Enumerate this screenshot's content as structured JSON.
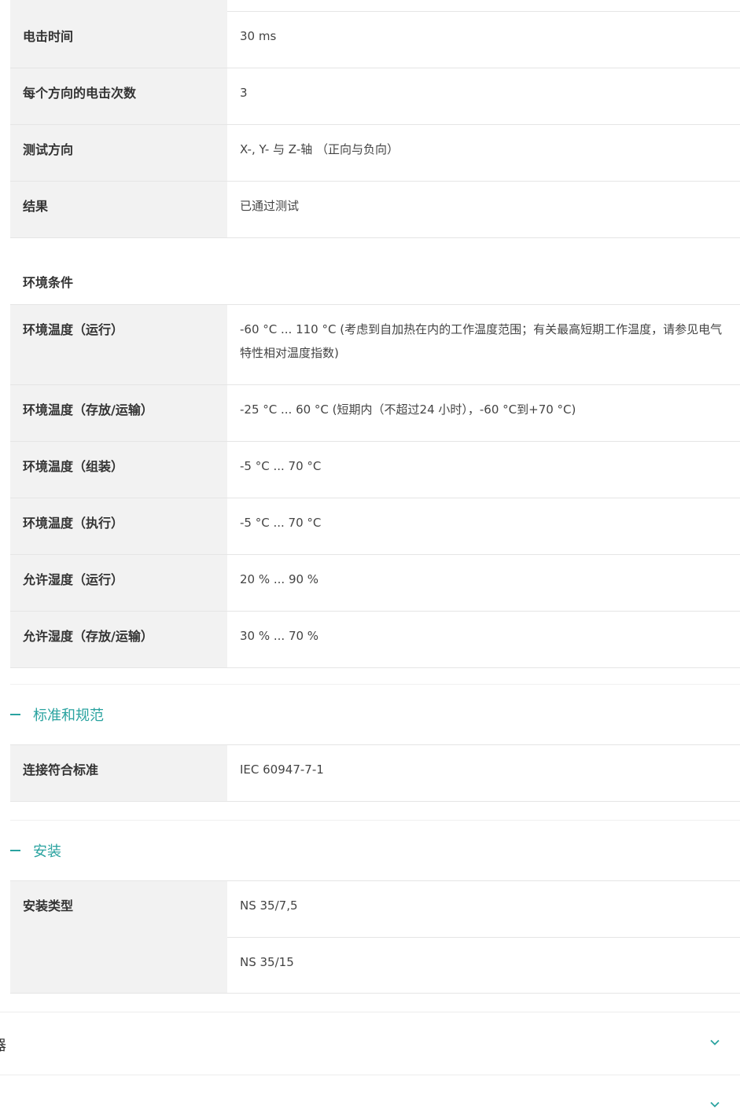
{
  "shock_rows": [
    {
      "label": "电击时间",
      "value": "30 ms"
    },
    {
      "label": "每个方向的电击次数",
      "value": "3"
    },
    {
      "label": "测试方向",
      "value": "X-, Y- 与 Z-轴 （正向与负向）"
    },
    {
      "label": "结果",
      "value": "已通过测试"
    }
  ],
  "env": {
    "heading": "环境条件",
    "rows": [
      {
        "label": "环境温度（运行）",
        "value": "-60 °C ... 110 °C (考虑到自加热在内的工作温度范围；有关最高短期工作温度，请参见电气特性相对温度指数)"
      },
      {
        "label": "环境温度（存放/运输）",
        "value": "-25 °C ... 60 °C (短期内（不超过24 小时），-60 °C到+70 °C)"
      },
      {
        "label": "环境温度（组装）",
        "value": "-5 °C ... 70 °C"
      },
      {
        "label": "环境温度（执行）",
        "value": "-5 °C ... 70 °C"
      },
      {
        "label": "允许湿度（运行）",
        "value": "20 % ... 90 %"
      },
      {
        "label": "允许湿度（存放/运输）",
        "value": "30 % ... 70 %"
      }
    ]
  },
  "standards": {
    "title": "标准和规范",
    "rows": [
      {
        "label": "连接符合标准",
        "value": "IEC 60947-7-1"
      }
    ]
  },
  "mounting": {
    "title": "安装",
    "label": "安装类型",
    "values": [
      "NS 35/7,5",
      "NS 35/15"
    ]
  },
  "collapsed_sections": [
    {
      "partial_text": "器"
    },
    {
      "partial_text": ""
    }
  ],
  "colors": {
    "accent": "#2aa3a0",
    "label_bg": "#f2f2f2",
    "border": "#e5e5e5"
  },
  "icons": {
    "collapse": "minus-icon",
    "expand": "chevron-down-icon"
  }
}
